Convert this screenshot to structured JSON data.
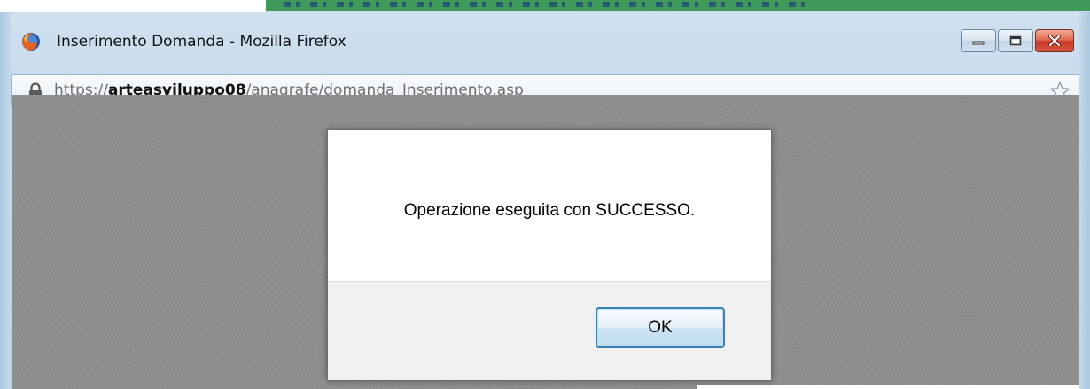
{
  "window": {
    "title": "Inserimento Domanda - Mozilla Firefox",
    "icon": "firefox-icon"
  },
  "window_controls": {
    "minimize_icon": "minimize-icon",
    "maximize_icon": "maximize-icon",
    "close_icon": "close-icon"
  },
  "urlbar": {
    "scheme": "https://",
    "host": "arteasviluppo08",
    "path": "/anagrafe/domanda_Inserimento.asp",
    "lock_icon": "lock-icon",
    "bookmark_icon": "star-icon"
  },
  "dialog": {
    "message": "Operazione eseguita con SUCCESSO.",
    "ok_label": "OK"
  },
  "colors": {
    "overlay": "#8f8f8f",
    "ok_border": "#3c7fb1",
    "close_button": "#c9392a"
  }
}
